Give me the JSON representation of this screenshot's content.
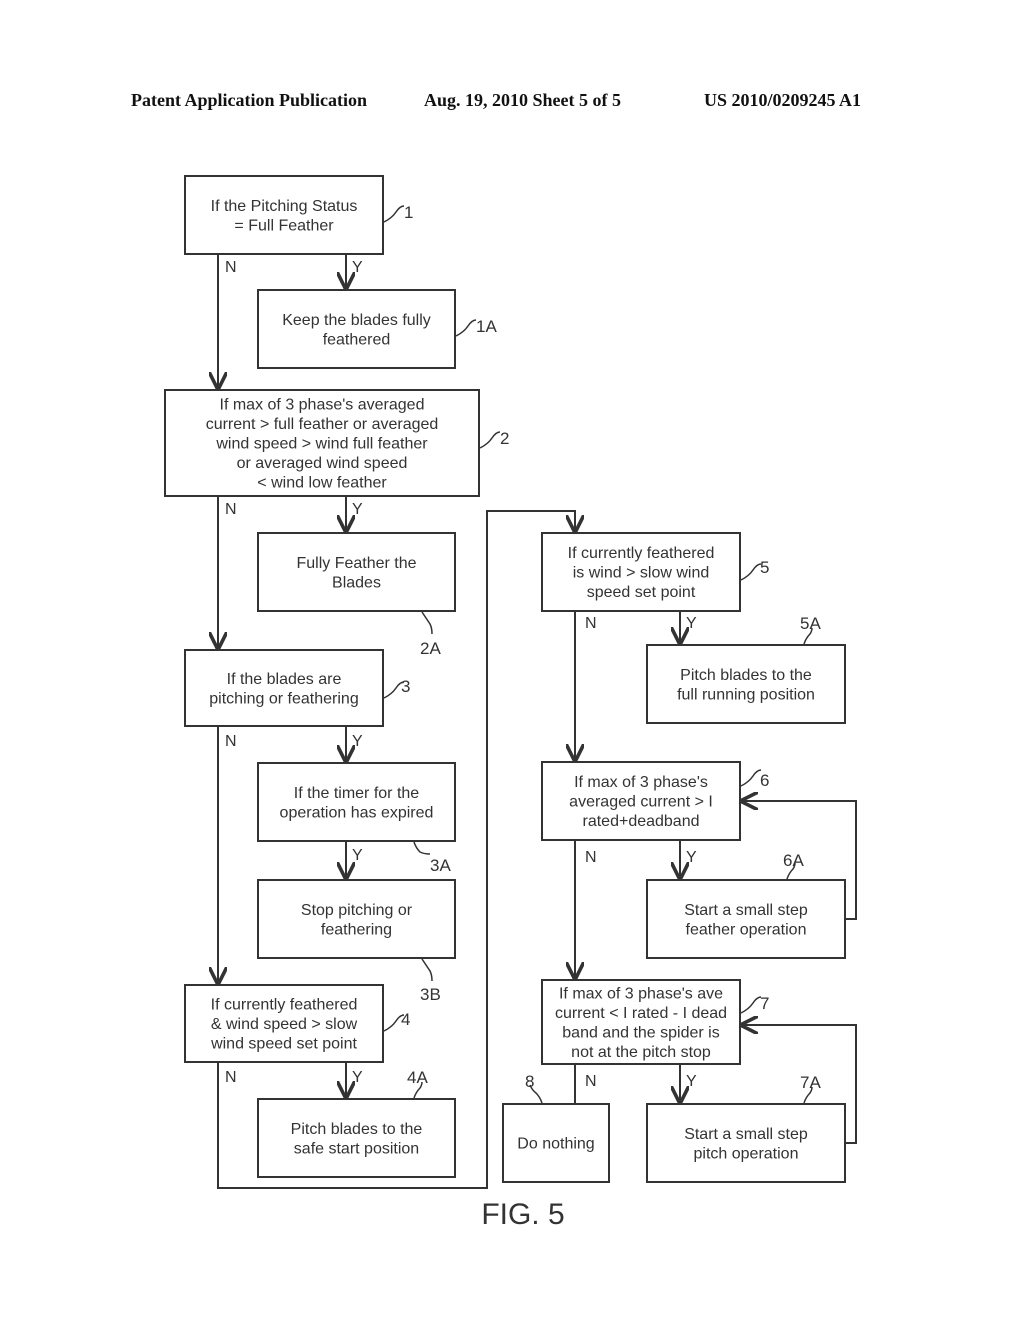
{
  "header": {
    "publication": "Patent Application Publication",
    "date_sheet": "Aug. 19, 2010  Sheet 5 of 5",
    "number": "US 2010/0209245 A1"
  },
  "figure_label": "FIG. 5",
  "branch_labels": {
    "yes": "Y",
    "no": "N"
  },
  "nodes": {
    "n1": {
      "ref": "1",
      "lines": [
        "If the Pitching Status",
        "= Full Feather"
      ]
    },
    "n1a": {
      "ref": "1A",
      "lines": [
        "Keep the blades fully",
        "feathered"
      ]
    },
    "n2": {
      "ref": "2",
      "lines": [
        "If max of 3 phase's averaged",
        "current > full feather or averaged",
        "wind speed > wind full feather",
        "or averaged wind speed",
        "< wind low feather"
      ]
    },
    "n2a": {
      "ref": "2A",
      "lines": [
        "Fully Feather the",
        "Blades"
      ]
    },
    "n3": {
      "ref": "3",
      "lines": [
        "If the blades are",
        "pitching or feathering"
      ]
    },
    "n3a": {
      "ref": "3A",
      "lines": [
        "If the timer for the",
        "operation has expired"
      ]
    },
    "n3b": {
      "ref": "3B",
      "lines": [
        "Stop pitching or",
        "feathering"
      ]
    },
    "n4": {
      "ref": "4",
      "lines": [
        "If currently feathered",
        "& wind speed > slow",
        "wind speed set point"
      ]
    },
    "n4a": {
      "ref": "4A",
      "lines": [
        "Pitch blades to the",
        "safe start position"
      ]
    },
    "n5": {
      "ref": "5",
      "lines": [
        "If currently feathered",
        "is wind > slow wind",
        "speed set point"
      ]
    },
    "n5a": {
      "ref": "5A",
      "lines": [
        "Pitch blades to the",
        "full running position"
      ]
    },
    "n6": {
      "ref": "6",
      "lines": [
        "If max of 3 phase's",
        "averaged current > I",
        "rated+deadband"
      ]
    },
    "n6a": {
      "ref": "6A",
      "lines": [
        "Start a small step",
        "feather operation"
      ]
    },
    "n7": {
      "ref": "7",
      "lines": [
        "If max of 3 phase's ave",
        "current < I rated - I dead",
        "band and the spider is",
        "not at the pitch stop"
      ]
    },
    "n7a": {
      "ref": "7A",
      "lines": [
        "Start a small step",
        "pitch operation"
      ]
    },
    "n8": {
      "ref": "8",
      "lines": [
        "Do nothing"
      ]
    }
  }
}
